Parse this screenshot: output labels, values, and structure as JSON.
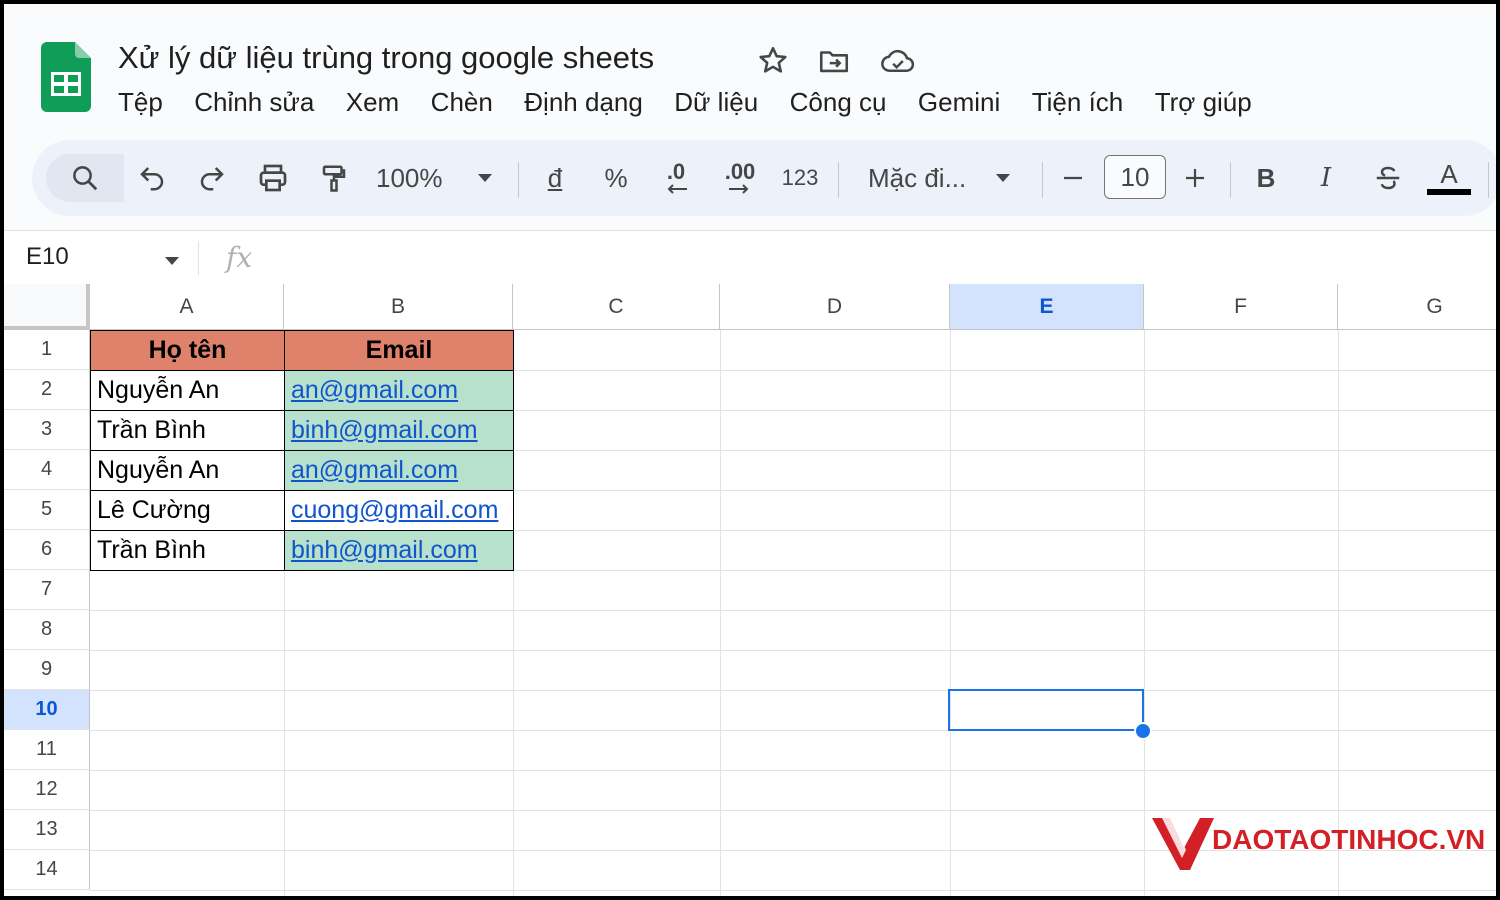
{
  "document": {
    "title": "Xử lý dữ liệu trùng trong google sheets",
    "menu": [
      "Tệp",
      "Chỉnh sửa",
      "Xem",
      "Chèn",
      "Định dạng",
      "Dữ liệu",
      "Công cụ",
      "Gemini",
      "Tiện ích",
      "Trợ giúp"
    ]
  },
  "toolbar": {
    "zoom": "100%",
    "currency": "đ",
    "percent": "%",
    "decrease_decimal": ".0",
    "increase_decimal": ".00",
    "number_format": "123",
    "font": "Mặc đi...",
    "font_size": "10",
    "bold": "B",
    "italic": "I",
    "text_color": "A"
  },
  "formula_bar": {
    "name_box": "E10",
    "fx": "fx"
  },
  "grid": {
    "columns": [
      "A",
      "B",
      "C",
      "D",
      "E",
      "F",
      "G"
    ],
    "rows": [
      "1",
      "2",
      "3",
      "4",
      "5",
      "6",
      "7",
      "8",
      "9",
      "10",
      "11",
      "12",
      "13",
      "14"
    ],
    "header": {
      "name": "Họ tên",
      "email": "Email"
    },
    "data": [
      {
        "name": "Nguyễn An",
        "email": "an@gmail.com",
        "highlight": true
      },
      {
        "name": "Trần Bình",
        "email": "binh@gmail.com",
        "highlight": true
      },
      {
        "name": "Nguyễn An",
        "email": "an@gmail.com",
        "highlight": true
      },
      {
        "name": "Lê Cường",
        "email": "cuong@gmail.com",
        "highlight": false
      },
      {
        "name": "Trần Bình",
        "email": "binh@gmail.com",
        "highlight": true
      }
    ],
    "selected_cell": "E10",
    "colors": {
      "header_fill": "#df826c",
      "duplicate_fill": "#b7e1cd",
      "selection": "#1a73e8"
    }
  },
  "watermark": {
    "text": "DAOTAOTINHOC.VN"
  }
}
